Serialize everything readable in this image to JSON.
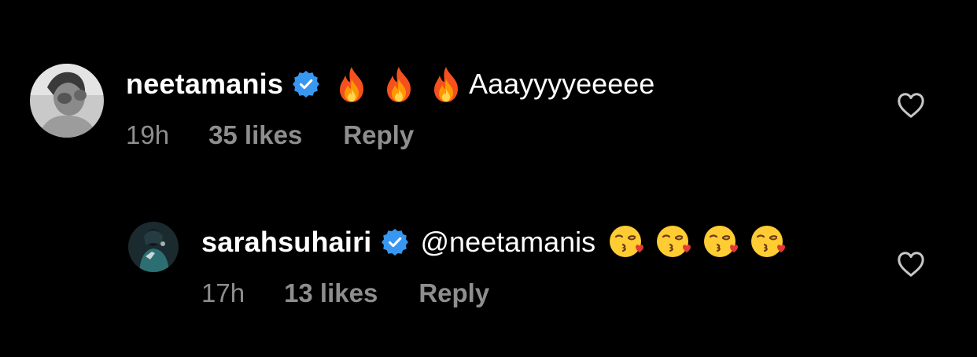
{
  "comments": [
    {
      "username": "neetamanis",
      "verified": true,
      "emoji": [
        "fire",
        "fire",
        "fire"
      ],
      "text": "Aaayyyyeeeee",
      "time": "19h",
      "likes": "35 likes",
      "reply": "Reply"
    },
    {
      "username": "sarahsuhairi",
      "verified": true,
      "mention": "@neetamanis",
      "emoji": [
        "face-blowing-a-kiss",
        "face-blowing-a-kiss",
        "face-blowing-a-kiss",
        "face-blowing-a-kiss"
      ],
      "time": "17h",
      "likes": "13 likes",
      "reply": "Reply"
    }
  ],
  "colors": {
    "background": "#000000",
    "text": "#ffffff",
    "meta": "#8e8e8e",
    "verified": "#3897f0"
  },
  "icons": {
    "verified": "verified-badge-icon",
    "like": "heart-outline-icon"
  }
}
